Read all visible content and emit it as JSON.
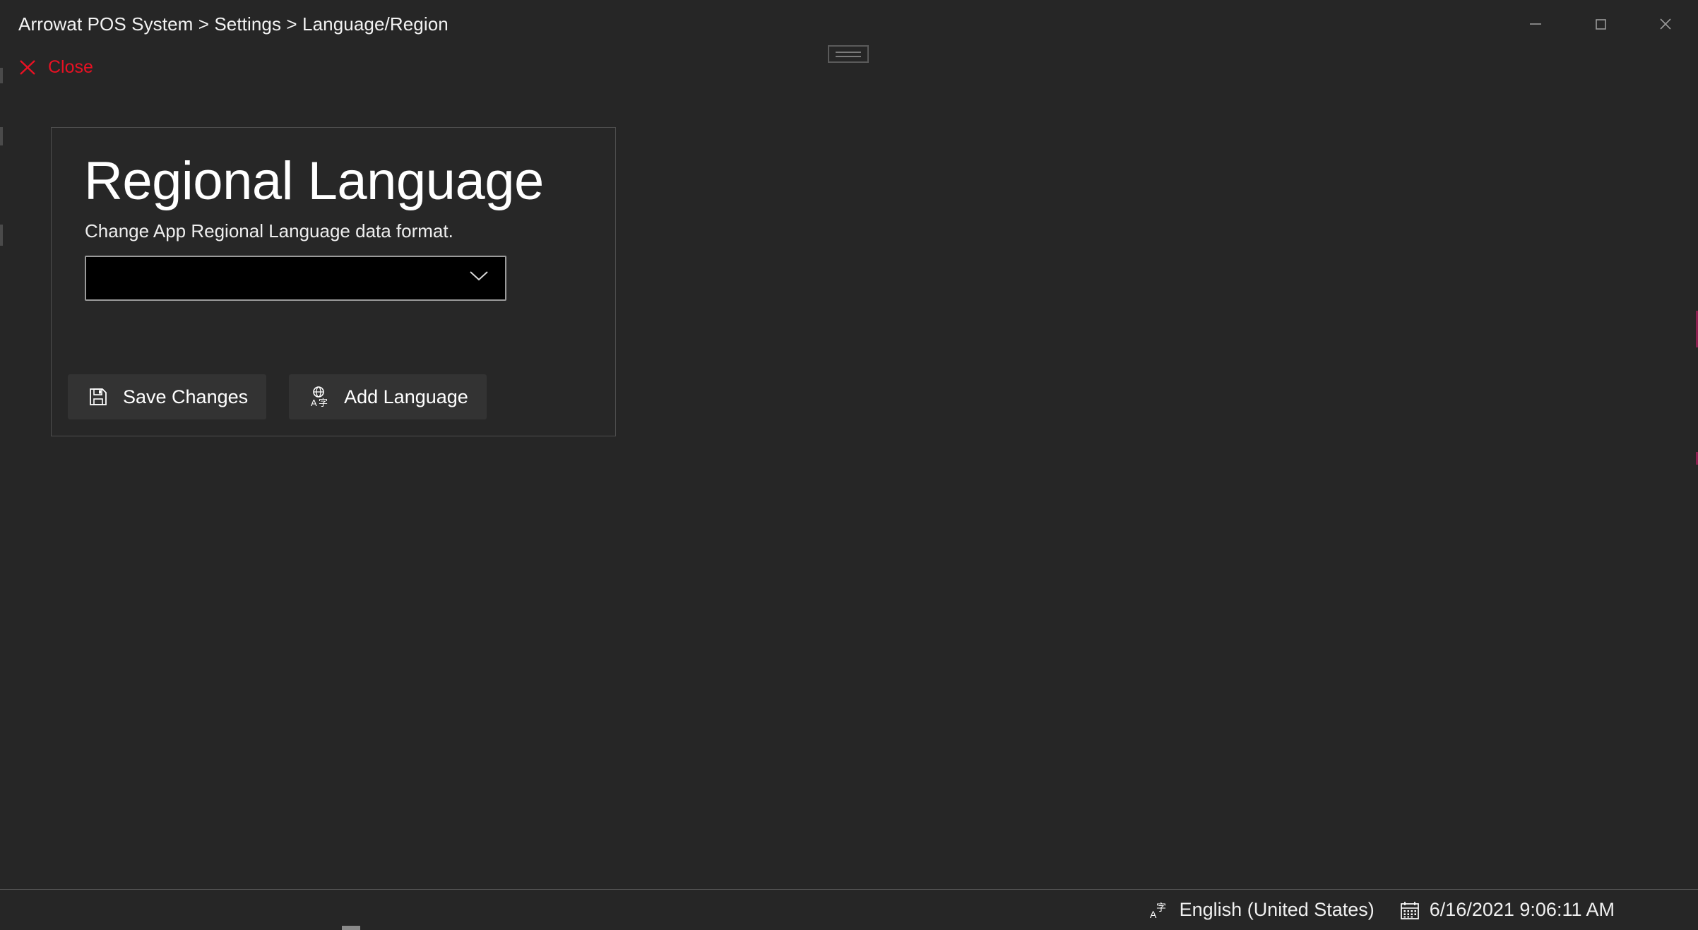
{
  "window": {
    "breadcrumb": "Arrowat POS System > Settings > Language/Region",
    "controls": {
      "minimize": "minimize-icon",
      "maximize": "maximize-icon",
      "close": "close-icon"
    }
  },
  "toolbar": {
    "close_label": "Close",
    "close_icon": "close-x-icon",
    "close_color": "#e81123"
  },
  "card": {
    "title": "Regional Language",
    "subtitle": "Change App Regional Language data format.",
    "dropdown": {
      "value": "",
      "placeholder": "",
      "chevron_icon": "chevron-down-icon"
    },
    "buttons": [
      {
        "label": "Save Changes",
        "icon": "save-floppy-icon"
      },
      {
        "label": "Add Language",
        "icon": "translate-globe-icon"
      }
    ]
  },
  "statusbar": {
    "language": "English (United States)",
    "language_icon": "translate-icon",
    "datetime": "6/16/2021 9:06:11 AM",
    "datetime_icon": "calendar-icon"
  },
  "colors": {
    "background": "#262626",
    "card_background": "#272727",
    "card_border": "#4e4e4e",
    "button_background": "#333333",
    "combo_background": "#000000",
    "combo_border": "#9a9a9a",
    "accent_red": "#e81123",
    "text": "#ffffff"
  }
}
